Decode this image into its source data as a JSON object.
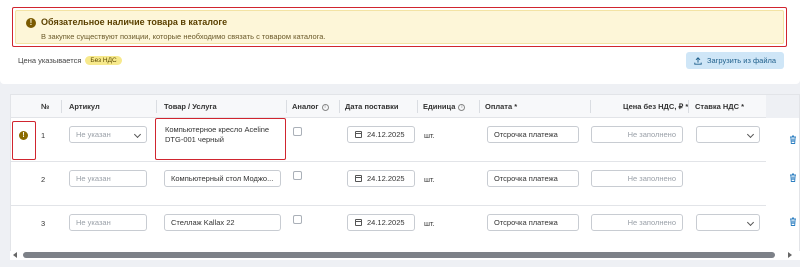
{
  "alert": {
    "icon": "warning-icon",
    "title": "Обязательное наличие товара в каталоге",
    "text": "В закупке существуют позиции, которые необходимо связать с товаром каталога."
  },
  "price": {
    "label": "Цена указывается",
    "badge": "Без НДС"
  },
  "upload_button": {
    "icon": "upload-icon",
    "label": "Загрузить из файла"
  },
  "table": {
    "headers": {
      "num": "№",
      "article": "Артикул",
      "product": "Товар / Услуга",
      "analog": "Аналог",
      "delivery_date": "Дата поставки",
      "unit": "Единица",
      "payment": "Оплата *",
      "price": "Цена без НДС, ₽ *",
      "vat": "Ставка НДС *"
    },
    "rows": [
      {
        "num": "1",
        "warning": true,
        "article": "Не указан",
        "article_is_select": true,
        "product": "Компьютерное кресло Aceline DTG-001 черный",
        "analog_checked": false,
        "delivery_date": "24.12.2025",
        "unit": "шт.",
        "payment": "Отсрочка платежа",
        "price_placeholder": "Не заполнено",
        "vat": ""
      },
      {
        "num": "2",
        "warning": false,
        "article": "Не указан",
        "article_is_select": false,
        "product": "Компьютерный стол Моджо...",
        "analog_checked": false,
        "delivery_date": "24.12.2025",
        "unit": "шт.",
        "payment": "Отсрочка платежа",
        "price_placeholder": "Не заполнено",
        "vat": ""
      },
      {
        "num": "3",
        "warning": false,
        "article": "Не указан",
        "article_is_select": false,
        "product": "Стеллаж Kallax 22",
        "analog_checked": false,
        "delivery_date": "24.12.2025",
        "unit": "шт.",
        "payment": "Отсрочка платежа",
        "price_placeholder": "Не заполнено",
        "vat": ""
      }
    ]
  },
  "colors": {
    "alert_bg": "#fdf6d8",
    "highlight_border": "#d0252f",
    "badge_bg": "#f7e98c",
    "upload_bg": "#cfe6f7",
    "trash_icon": "#2d7fc1"
  }
}
